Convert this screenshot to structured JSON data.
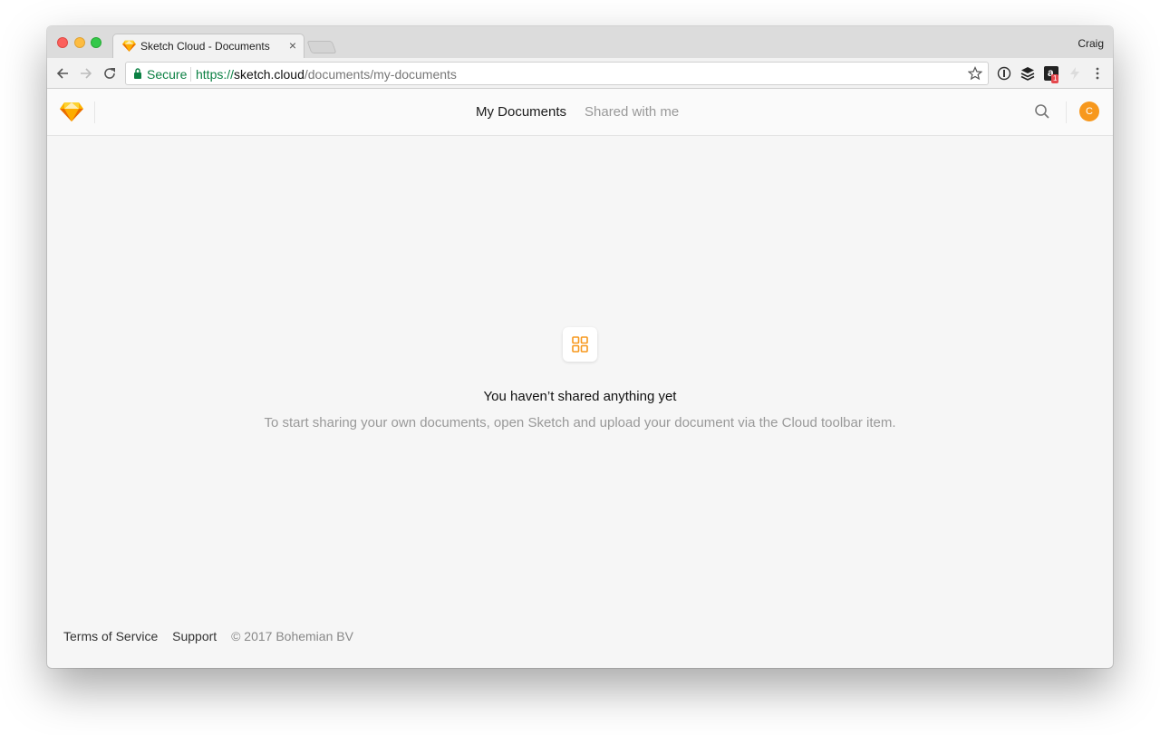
{
  "browser": {
    "tab_title": "Sketch Cloud - Documents",
    "tab_close": "×",
    "profile_name": "Craig",
    "secure_label": "Secure",
    "url_scheme": "https://",
    "url_host": "sketch.cloud",
    "url_path": "/documents/my-documents",
    "extension_badge": "1",
    "extension_letter": "a",
    "icons": [
      "back-arrow-icon",
      "forward-arrow-icon",
      "reload-icon",
      "lock-icon",
      "bookmark-star-icon",
      "onepassword-icon",
      "buffer-icon",
      "extension-icon",
      "lightning-icon",
      "kebab-menu-icon"
    ]
  },
  "header": {
    "tabs": [
      {
        "label": "My Documents",
        "active": true
      },
      {
        "label": "Shared with me",
        "active": false
      }
    ],
    "avatar_initial": "C",
    "icons": [
      "sketch-logo-icon",
      "search-icon"
    ]
  },
  "empty_state": {
    "icon": "grid-icon",
    "title": "You haven’t shared anything yet",
    "description": "To start sharing your own documents, open Sketch and upload your document via the Cloud toolbar item."
  },
  "footer": {
    "links": [
      "Terms of Service",
      "Support"
    ],
    "copyright": "© 2017 Bohemian BV"
  },
  "colors": {
    "accent": "#f7981d",
    "secure_green": "#0b8043",
    "background": "#f6f6f6"
  }
}
